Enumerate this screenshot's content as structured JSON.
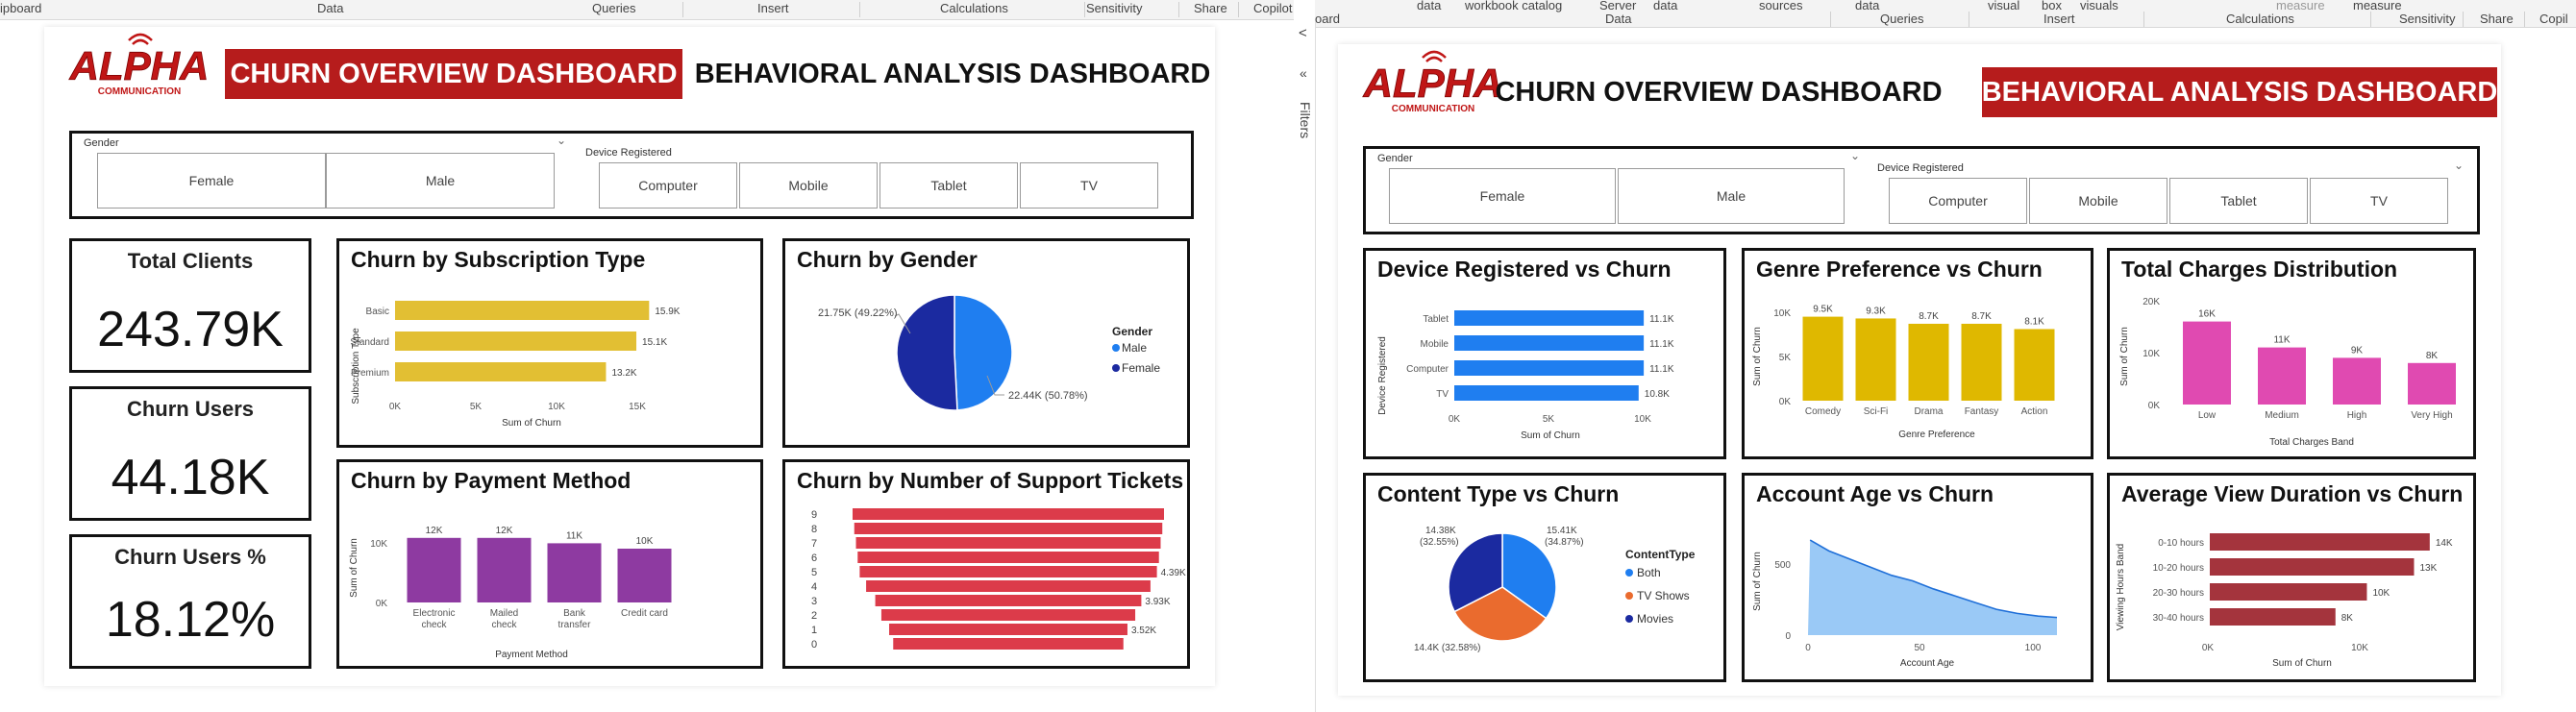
{
  "left_ribbon": {
    "items": [
      "ipboard",
      "Data",
      "Queries",
      "Insert",
      "Calculations",
      "Sensitivity",
      "Share",
      "Copilot"
    ]
  },
  "right_ribbon": {
    "top_items": [
      "data",
      "workbook catalog",
      "Server",
      "data",
      "sources",
      "data",
      "visual",
      "box",
      "visuals",
      "measure",
      "measure"
    ],
    "groups": [
      "oard",
      "Data",
      "Queries",
      "Insert",
      "Calculations",
      "Sensitivity",
      "Share",
      "Copil"
    ]
  },
  "filters_pane": {
    "label": "Filters",
    "collapse_glyph": "«",
    "chevron": "<"
  },
  "logo": {
    "text": "ALPHA",
    "subtext": "COMMUNICATION"
  },
  "colors": {
    "brand_red": "#b61c1c",
    "yellow": "#e2bf33",
    "purple": "#8e3aa1",
    "red_funnel": "#dc3b4a",
    "blue": "#1f7ef0",
    "navy": "#1b2aa0",
    "gold": "#dfb800",
    "magenta": "#e04ab1",
    "orange": "#ea6b2e",
    "light_blue": "#8fc3f5",
    "dark_red": "#a4343d"
  },
  "left": {
    "nav_active": "CHURN OVERVIEW DASHBOARD",
    "nav_other": "BEHAVIORAL ANALYSIS DASHBOARD",
    "gender_slicer": {
      "label": "Gender",
      "options": [
        "Female",
        "Male"
      ]
    },
    "device_slicer": {
      "label": "Device Registered",
      "options": [
        "Computer",
        "Mobile",
        "Tablet",
        "TV"
      ]
    },
    "kpis": [
      {
        "title": "Total Clients",
        "value": "243.79K"
      },
      {
        "title": "Churn Users",
        "value": "44.18K"
      },
      {
        "title": "Churn Users %",
        "value": "18.12%"
      }
    ],
    "subscription": {
      "title": "Churn by Subscription Type",
      "ylabel": "Subscription Type",
      "xlabel": "Sum of Churn",
      "ticks": [
        "0K",
        "5K",
        "10K",
        "15K"
      ]
    },
    "gender": {
      "title": "Churn by Gender",
      "legend_title": "Gender",
      "label_male": "21.75K (49.22%)",
      "label_female": "22.44K (50.78%)"
    },
    "payment": {
      "title": "Churn by Payment Method",
      "ylabel": "Sum of Churn",
      "xlabel": "Payment Method",
      "yticks": [
        "10K",
        "0K"
      ]
    },
    "tickets": {
      "title": "Churn by  Number of Support Tickets"
    }
  },
  "right": {
    "nav_other": "CHURN OVERVIEW DASHBOARD",
    "nav_active": "BEHAVIORAL ANALYSIS DASHBOARD",
    "gender_slicer": {
      "label": "Gender",
      "options": [
        "Female",
        "Male"
      ]
    },
    "device_slicer": {
      "label": "Device Registered",
      "options": [
        "Computer",
        "Mobile",
        "Tablet",
        "TV"
      ]
    },
    "device": {
      "title": "Device Registered vs Churn",
      "ylabel": "Device Registered",
      "xlabel": "Sum of Churn",
      "ticks": [
        "0K",
        "5K",
        "10K"
      ]
    },
    "genre": {
      "title": "Genre Preference vs Churn",
      "ylabel": "Sum of Churn",
      "xlabel": "Genre Preference",
      "yticks": [
        "10K",
        "5K",
        "0K"
      ]
    },
    "charges": {
      "title": "Total Charges Distribution",
      "ylabel": "Sum of Churn",
      "xlabel": "Total Charges Band",
      "yticks": [
        "20K",
        "10K",
        "0K"
      ]
    },
    "content": {
      "title": "Content Type vs Churn",
      "legend_title": "ContentType",
      "label_movies": "14.38K",
      "label_movies_pct": "(32.55%)",
      "label_both": "15.41K",
      "label_both_pct": "(34.87%)",
      "label_tv": "14.4K (32.58%)"
    },
    "age": {
      "title": "Account Age vs Churn",
      "ylabel": "Sum of Churn",
      "xlabel": "Account Age",
      "yticks": [
        "500",
        "0"
      ],
      "xticks": [
        "0",
        "50",
        "100"
      ]
    },
    "view": {
      "title": "Average View Duration vs Churn",
      "ylabel": "Viewing Hours Band",
      "xlabel": "Sum of Churn",
      "ticks": [
        "0K",
        "10K"
      ]
    }
  },
  "chart_data": [
    {
      "type": "bar",
      "orientation": "horizontal",
      "title": "Churn by Subscription Type",
      "categories": [
        "Basic",
        "Standard",
        "Premium"
      ],
      "values": [
        15.9,
        15.1,
        13.2
      ],
      "labels": [
        "15.9K",
        "15.1K",
        "13.2K"
      ],
      "xlim": [
        0,
        16
      ],
      "xlabel": "Sum of Churn",
      "ylabel": "Subscription Type"
    },
    {
      "type": "pie",
      "title": "Churn by Gender",
      "categories": [
        "Male",
        "Female"
      ],
      "values": [
        21.75,
        22.44
      ],
      "percents": [
        49.22,
        50.78
      ],
      "colors": [
        "#1f7ef0",
        "#1b2aa0"
      ],
      "legend_labels": [
        "Male",
        "Female"
      ]
    },
    {
      "type": "bar",
      "title": "Churn by Payment Method",
      "categories": [
        "Electronic check",
        "Mailed check",
        "Bank transfer",
        "Credit card"
      ],
      "tick_lines": [
        [
          "Electronic",
          "check"
        ],
        [
          "Mailed",
          "check"
        ],
        [
          "Bank",
          "transfer"
        ],
        [
          "Credit card"
        ]
      ],
      "values": [
        12,
        12,
        11,
        10
      ],
      "labels": [
        "12K",
        "12K",
        "11K",
        "10K"
      ],
      "ylim": [
        0,
        12.5
      ],
      "xlabel": "Payment Method",
      "ylabel": "Sum of Churn"
    },
    {
      "type": "bar",
      "subtype": "funnel",
      "title": "Churn by  Number of Support Tickets",
      "categories": [
        "9",
        "8",
        "7",
        "6",
        "5",
        "4",
        "3",
        "2",
        "1",
        "0"
      ],
      "values": [
        4.6,
        4.55,
        4.5,
        4.45,
        4.39,
        4.2,
        3.93,
        3.75,
        3.52,
        3.4
      ],
      "labels": [
        "",
        "",
        "",
        "",
        "4.39K",
        "",
        "3.93K",
        "",
        "3.52K",
        ""
      ]
    },
    {
      "type": "bar",
      "orientation": "horizontal",
      "title": "Device Registered vs Churn",
      "categories": [
        "Tablet",
        "Mobile",
        "Computer",
        "TV"
      ],
      "values": [
        11.1,
        11.1,
        11.1,
        10.8
      ],
      "labels": [
        "11.1K",
        "11.1K",
        "11.1K",
        "10.8K"
      ],
      "xlim": [
        0,
        11.6
      ],
      "xlabel": "Sum of Churn",
      "ylabel": "Device Registered"
    },
    {
      "type": "bar",
      "title": "Genre Preference vs Churn",
      "categories": [
        "Comedy",
        "Sci-Fi",
        "Drama",
        "Fantasy",
        "Action"
      ],
      "values": [
        9.5,
        9.3,
        8.7,
        8.7,
        8.1
      ],
      "labels": [
        "9.5K",
        "9.3K",
        "8.7K",
        "8.7K",
        "8.1K"
      ],
      "ylim": [
        0,
        10
      ],
      "xlabel": "Genre Preference",
      "ylabel": "Sum of Churn"
    },
    {
      "type": "bar",
      "title": "Total Charges Distribution",
      "categories": [
        "Low",
        "Medium",
        "High",
        "Very High"
      ],
      "values": [
        16,
        11,
        9,
        8
      ],
      "labels": [
        "16K",
        "11K",
        "9K",
        "8K"
      ],
      "ylim": [
        0,
        20
      ],
      "xlabel": "Total Charges Band",
      "ylabel": "Sum of Churn"
    },
    {
      "type": "pie",
      "title": "Content Type vs Churn",
      "categories": [
        "Both",
        "TV Shows",
        "Movies"
      ],
      "values": [
        15.41,
        14.4,
        14.38
      ],
      "percents": [
        34.87,
        32.58,
        32.55
      ],
      "colors": [
        "#1f7ef0",
        "#ea6b2e",
        "#1b2aa0"
      ],
      "legend_labels": [
        "Both",
        "TV Shows",
        "Movies"
      ]
    },
    {
      "type": "area",
      "title": "Account Age vs Churn",
      "x": [
        1,
        10,
        20,
        30,
        40,
        50,
        60,
        70,
        80,
        90,
        100,
        110,
        119
      ],
      "values": [
        700,
        620,
        560,
        500,
        440,
        400,
        340,
        290,
        240,
        190,
        160,
        140,
        130
      ],
      "xlim": [
        0,
        119
      ],
      "ylim": [
        0,
        750
      ],
      "xlabel": "Account Age",
      "ylabel": "Sum of Churn"
    },
    {
      "type": "bar",
      "orientation": "horizontal",
      "title": "Average View Duration vs Churn",
      "categories": [
        "0-10 hours",
        "10-20 hours",
        "20-30 hours",
        "30-40 hours"
      ],
      "values": [
        14,
        13,
        10,
        8
      ],
      "labels": [
        "14K",
        "13K",
        "10K",
        "8K"
      ],
      "xlim": [
        0,
        14.5
      ],
      "xlabel": "Sum of Churn",
      "ylabel": "Viewing Hours Band"
    }
  ]
}
